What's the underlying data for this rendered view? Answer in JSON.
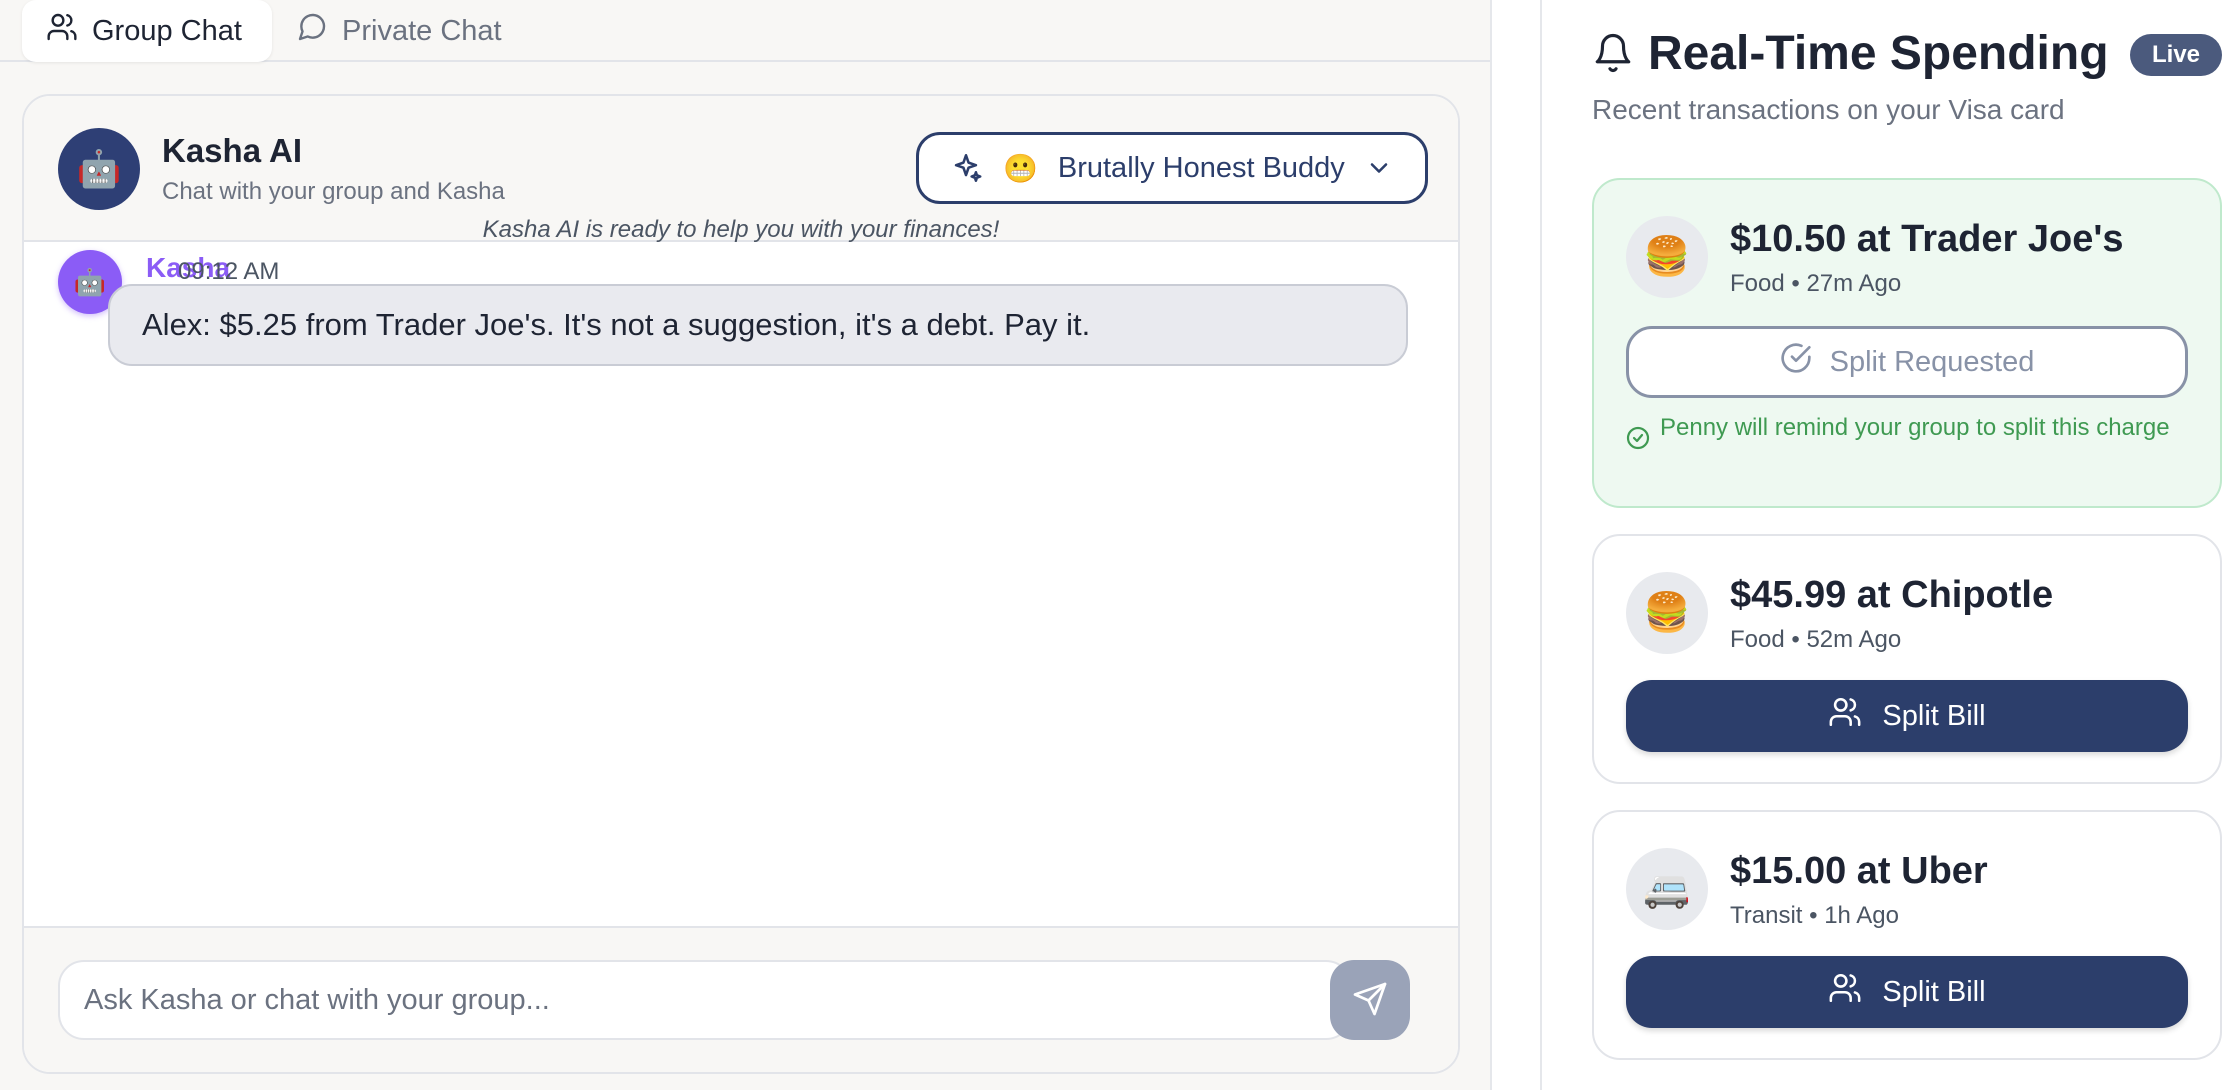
{
  "tabs": [
    {
      "label": "Group Chat",
      "icon": "users-icon",
      "active": true
    },
    {
      "label": "Private Chat",
      "icon": "message-circle-icon",
      "active": false
    }
  ],
  "chat": {
    "avatar_icon": "robot-icon",
    "avatar_emoji": "🤖",
    "title": "Kasha AI",
    "subtitle": "Chat with your group and Kasha",
    "persona": {
      "emoji": "😬",
      "label": "Brutally Honest Buddy",
      "icon": "sparkles-icon"
    },
    "system_note": "Kasha AI is ready to help you with your finances!",
    "messages": [
      {
        "sender": "Kasha",
        "time": "09:12 AM",
        "avatar_emoji": "🤖",
        "text": "Alex: $5.25 from Trader Joe's. It's not a suggestion, it's a debt. Pay it."
      }
    ],
    "input_placeholder": "Ask Kasha or chat with your group...",
    "send_icon": "send-icon"
  },
  "spending": {
    "title": "Real-Time Spending",
    "badge": "Live",
    "subtitle": "Recent transactions on your Visa card",
    "transactions": [
      {
        "emoji": "🍔",
        "title": "$10.50 at Trader Joe's",
        "meta": "Food • 27m Ago",
        "status": "requested",
        "button_label": "Split Requested",
        "note": "Penny will remind your group to split this charge"
      },
      {
        "emoji": "🍔",
        "title": "$45.99 at Chipotle",
        "meta": "Food • 52m Ago",
        "status": "open",
        "button_label": "Split Bill"
      },
      {
        "emoji": "🚐",
        "title": "$15.00 at Uber",
        "meta": "Transit • 1h Ago",
        "status": "open",
        "button_label": "Split Bill"
      }
    ]
  },
  "colors": {
    "brand_navy": "#2c3e6b",
    "accent_purple": "#8b5cf6",
    "success_green": "#3f9a52",
    "success_bg": "#eef9f1"
  }
}
